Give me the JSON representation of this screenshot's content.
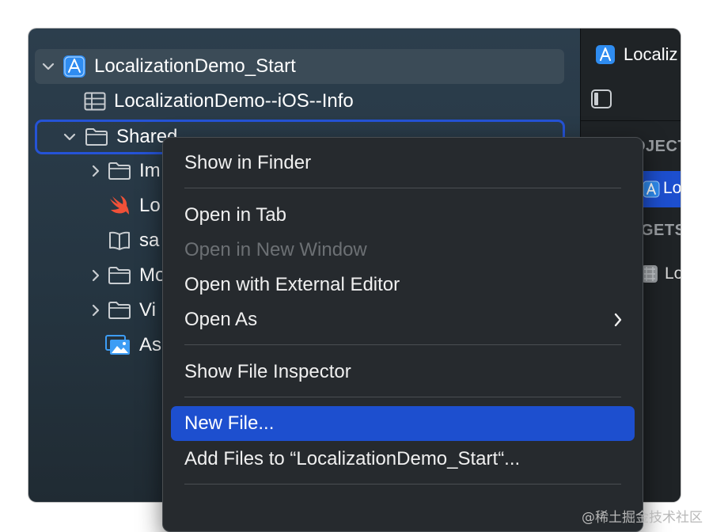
{
  "navigator": {
    "root": {
      "label": "LocalizationDemo_Start",
      "icon": "app-project-icon"
    },
    "info_plist": {
      "label": "LocalizationDemo--iOS--Info",
      "icon": "table-icon"
    },
    "shared": {
      "label": "Shared",
      "icon": "folder-icon"
    },
    "children": [
      {
        "label": "Im",
        "icon": "folder-icon",
        "expandable": true
      },
      {
        "label": "Lo",
        "icon": "swift-icon",
        "expandable": false
      },
      {
        "label": "sa",
        "icon": "book-icon",
        "expandable": false
      },
      {
        "label": "Mo",
        "icon": "folder-icon",
        "expandable": true
      },
      {
        "label": "Vi",
        "icon": "folder-icon",
        "expandable": true
      },
      {
        "label": "As",
        "icon": "assets-icon",
        "expandable": false
      }
    ]
  },
  "context_menu": {
    "items": [
      {
        "label": "Show in Finder",
        "state": "normal"
      },
      {
        "label": "Open in Tab",
        "state": "normal"
      },
      {
        "label": "Open in New Window",
        "state": "disabled"
      },
      {
        "label": "Open with External Editor",
        "state": "normal"
      },
      {
        "label": "Open As",
        "state": "normal",
        "submenu": true
      },
      {
        "label": "Show File Inspector",
        "state": "normal"
      },
      {
        "label": "New File...",
        "state": "selected"
      },
      {
        "label": "Add Files to “LocalizationDemo_Start“...",
        "state": "normal"
      }
    ]
  },
  "right_pane": {
    "title": "Localiz",
    "project_section": "OJECT",
    "project_item": "Lo",
    "targets_section": "GETS",
    "target_item": "Lo"
  },
  "colors": {
    "accent": "#1d4fcf",
    "selection_outline": "#2553d6",
    "swift": "#f05138",
    "icon_blue": "#3d9df5"
  },
  "watermark": "@稀土掘金技术社区"
}
